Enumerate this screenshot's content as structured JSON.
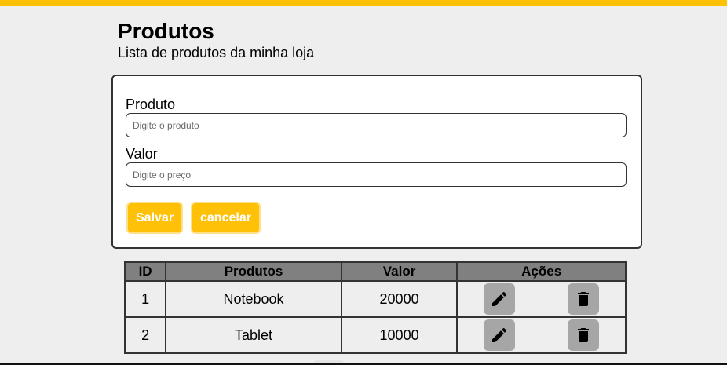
{
  "header": {
    "title": "Produtos",
    "subtitle": "Lista de produtos da minha loja"
  },
  "form": {
    "product_label": "Produto",
    "product_placeholder": "Digite o produto",
    "product_value": "",
    "price_label": "Valor",
    "price_placeholder": "Digite o preço",
    "price_value": "",
    "save_label": "Salvar",
    "cancel_label": "cancelar"
  },
  "table": {
    "headers": [
      "ID",
      "Produtos",
      "Valor",
      "Ações"
    ],
    "rows": [
      {
        "id": "1",
        "product": "Notebook",
        "value": "20000"
      },
      {
        "id": "2",
        "product": "Tablet",
        "value": "10000"
      }
    ],
    "edit_icon": "pencil-icon",
    "delete_icon": "trash-icon"
  },
  "colors": {
    "accent": "#ffc107",
    "header_bg": "#808080",
    "icon_button_bg": "#a6a6a6",
    "page_bg": "#eeeeee"
  }
}
